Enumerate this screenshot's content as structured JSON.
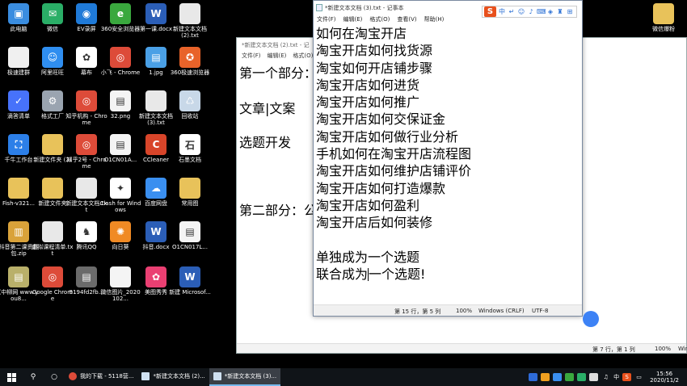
{
  "desktop": {
    "icons": [
      {
        "label": "此电脑",
        "icon": "computer-icon",
        "color": "#3a8de0",
        "glyph": "▣"
      },
      {
        "label": "微信",
        "icon": "wechat-icon",
        "color": "#2aae67",
        "glyph": "✉"
      },
      {
        "label": "EV录屏",
        "icon": "ev-recorder-icon",
        "color": "#1f7ad8",
        "glyph": "◉"
      },
      {
        "label": "360安全浏览器",
        "icon": "browser-360-icon",
        "color": "#3aa83e",
        "glyph": "e"
      },
      {
        "label": "第一课.docx",
        "icon": "word-doc-icon",
        "color": "#2b5eb7",
        "glyph": "W"
      },
      {
        "label": "新建文本文档 (2).txt",
        "icon": "text-file-icon",
        "color": "#e8e8e8",
        "glyph": ""
      },
      {
        "label": "极速建群",
        "icon": "file-icon",
        "color": "#f0f0f0",
        "glyph": ""
      },
      {
        "label": "阿里旺旺",
        "icon": "aliwangwang-icon",
        "color": "#2f8ef0",
        "glyph": "☺"
      },
      {
        "label": "幕布",
        "icon": "mubu-icon",
        "color": "#ffffff",
        "glyph": "✿"
      },
      {
        "label": "小飞 - Chrome",
        "icon": "chrome-icon",
        "color": "#dd4b39",
        "glyph": "◎"
      },
      {
        "label": "1.jpg",
        "icon": "image-file-icon",
        "color": "#4aa0e6",
        "glyph": "▤"
      },
      {
        "label": "360极速浏览器",
        "icon": "browser-360-speed-icon",
        "color": "#e8632a",
        "glyph": "✪"
      },
      {
        "label": "滴答清单",
        "icon": "ticktick-icon",
        "color": "#4772fa",
        "glyph": "✓"
      },
      {
        "label": "格式工厂",
        "icon": "format-factory-icon",
        "color": "#9aa4b0",
        "glyph": "⚙"
      },
      {
        "label": "知乎机构 - Chrome",
        "icon": "chrome-icon",
        "color": "#dd4b39",
        "glyph": "◎"
      },
      {
        "label": "32.png",
        "icon": "image-file-icon",
        "color": "#f4f4f4",
        "glyph": "▤"
      },
      {
        "label": "新建文本文档 (3).txt",
        "icon": "text-file-icon",
        "color": "#e8e8e8",
        "glyph": ""
      },
      {
        "label": "回收站",
        "icon": "recycle-bin-icon",
        "color": "#c8d8e8",
        "glyph": "♺"
      },
      {
        "label": "千牛工作台",
        "icon": "qianniu-icon",
        "color": "#2c7fe8",
        "glyph": "⛶"
      },
      {
        "label": "新建文件夹 (2)",
        "icon": "folder-icon",
        "color": "#e8c25a",
        "glyph": ""
      },
      {
        "label": "知乎2号 - Chrome",
        "icon": "chrome-icon",
        "color": "#dd4b39",
        "glyph": "◎"
      },
      {
        "label": "O1CN01A...",
        "icon": "image-file-icon",
        "color": "#f4f4f4",
        "glyph": "▤"
      },
      {
        "label": "CCleaner",
        "icon": "ccleaner-icon",
        "color": "#d8452a",
        "glyph": "C"
      },
      {
        "label": "石墨文档",
        "icon": "shimo-icon",
        "color": "#ffffff",
        "glyph": "石"
      },
      {
        "label": "Fish-v321...",
        "icon": "folder-icon",
        "color": "#e8c25a",
        "glyph": ""
      },
      {
        "label": "新建文件夹",
        "icon": "folder-icon",
        "color": "#e8c25a",
        "glyph": ""
      },
      {
        "label": "新建文本文档.txt",
        "icon": "text-file-icon",
        "color": "#e8e8e8",
        "glyph": ""
      },
      {
        "label": "Clash for Windows",
        "icon": "clash-icon",
        "color": "#ffffff",
        "glyph": "✦"
      },
      {
        "label": "百度网盘",
        "icon": "baidu-netdisk-icon",
        "color": "#3a8ff0",
        "glyph": "☁"
      },
      {
        "label": "常用图",
        "icon": "folder-icon",
        "color": "#e8c25a",
        "glyph": ""
      },
      {
        "label": "抖音第二课资料包.zip",
        "icon": "zip-file-icon",
        "color": "#d9a23a",
        "glyph": "▥"
      },
      {
        "label": "虚拟课程清单.txt",
        "icon": "text-file-icon",
        "color": "#e8e8e8",
        "glyph": ""
      },
      {
        "label": "腾讯QQ",
        "icon": "qq-icon",
        "color": "#ffffff",
        "glyph": "♞"
      },
      {
        "label": "向日葵",
        "icon": "sunflower-icon",
        "color": "#f08a24",
        "glyph": "✺"
      },
      {
        "label": "抖音.docx",
        "icon": "word-doc-icon",
        "color": "#2b5eb7",
        "glyph": "W"
      },
      {
        "label": "O1CN017L...",
        "icon": "image-file-icon",
        "color": "#f4f4f4",
        "glyph": "▤"
      },
      {
        "label": "(中柳网 www.you8...",
        "icon": "text-file-icon",
        "color": "#b9b06a",
        "glyph": "▤"
      },
      {
        "label": "Google Chrome",
        "icon": "chrome-icon",
        "color": "#dd4b39",
        "glyph": "◎"
      },
      {
        "label": "9194fd2fb...",
        "icon": "image-file-icon",
        "color": "#6b6b6b",
        "glyph": "▤"
      },
      {
        "label": "微信图片_2020102...",
        "icon": "image-file-icon",
        "color": "#f4f4f4",
        "glyph": ""
      },
      {
        "label": "美图秀秀",
        "icon": "meitu-icon",
        "color": "#ea3f72",
        "glyph": "✿"
      },
      {
        "label": "新建 Microsof...",
        "icon": "word-doc-icon",
        "color": "#2b5eb7",
        "glyph": "W"
      }
    ],
    "right_icon": {
      "label": "微信爆粉",
      "icon": "folder-icon",
      "color": "#e8c25a"
    }
  },
  "bg_notepad": {
    "title": "*新建文本文档 (2).txt - 记",
    "menu": [
      "文件(F)",
      "编辑(E)",
      "格式(O)"
    ],
    "lines": [
      "第一个部分：",
      "文章|文案",
      "选题开发",
      "第二部分：公"
    ],
    "status": {
      "position": "第 7 行，第 1 列",
      "zoom": "100%",
      "extra": "Wine"
    }
  },
  "notepad": {
    "title": "*新建文本文档 (3).txt - 记事本",
    "menu": [
      "文件(F)",
      "编辑(E)",
      "格式(O)",
      "查看(V)",
      "帮助(H)"
    ],
    "ime": {
      "logo": "S",
      "mode": "中"
    },
    "lines": [
      "如何在淘宝开店",
      "淘宝开店如何找货源",
      "淘宝如何开店铺步骤",
      "淘宝开店如何进货",
      "淘宝开店如何推广",
      "淘宝开店如何交保证金",
      "淘宝开店如何做行业分析",
      "手机如何在淘宝开店流程图",
      "淘宝开店如何维护店铺评价",
      "淘宝开店如何打造爆款",
      "淘宝开店如何盈利",
      "淘宝开店后如何装修",
      "",
      "单独成为一个选题",
      "联合成为一个选题!"
    ],
    "status": {
      "position": "第 15 行，第 5 列",
      "zoom": "100%",
      "eol": "Windows (CRLF)",
      "encoding": "UTF-8"
    }
  },
  "taskbar": {
    "apps": [
      {
        "label": "我的下载 - 5118营...",
        "icon": "chrome-icon",
        "active": false
      },
      {
        "label": "*新建文本文档 (2)...",
        "icon": "notepad-icon",
        "active": false
      },
      {
        "label": "*新建文本文档 (3)...",
        "icon": "notepad-icon",
        "active": true
      }
    ],
    "tray_ime": "中",
    "time": "15:56",
    "date": "2020/11/2"
  }
}
